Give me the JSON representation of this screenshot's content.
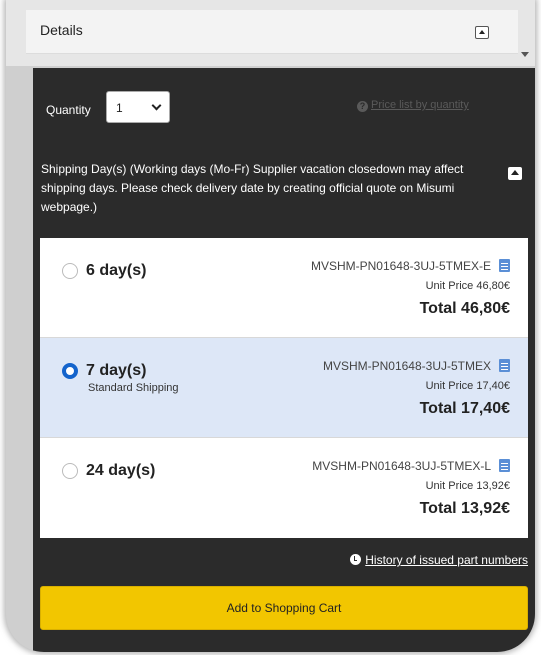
{
  "details": {
    "title": "Details"
  },
  "quantity": {
    "label": "Quantity",
    "selected": "1",
    "price_list_link": "Price list by quantity"
  },
  "shipping": {
    "header": "Shipping Day(s) (Working days (Mo-Fr) Supplier vacation closedown may affect shipping days. Please check delivery date by creating official quote on Misumi webpage.)",
    "options": [
      {
        "days": "6 day(s)",
        "note": "",
        "part_number": "MVSHM-PN01648-3UJ-5TMEX-E",
        "unit_price": "Unit Price 46,80€",
        "total": "Total 46,80€",
        "selected": false
      },
      {
        "days": "7 day(s)",
        "note": "Standard Shipping",
        "part_number": "MVSHM-PN01648-3UJ-5TMEX",
        "unit_price": "Unit Price 17,40€",
        "total": "Total 17,40€",
        "selected": true
      },
      {
        "days": "24 day(s)",
        "note": "",
        "part_number": "MVSHM-PN01648-3UJ-5TMEX-L",
        "unit_price": "Unit Price 13,92€",
        "total": "Total 13,92€",
        "selected": false
      }
    ]
  },
  "history_link": "History of issued part numbers",
  "cart_button": "Add to Shopping Cart",
  "icons": {
    "question": "question-circle-icon",
    "clock": "clock-icon",
    "document": "document-icon"
  },
  "colors": {
    "panel_bg": "#2b2b2b",
    "selected_row": "#dde7f7",
    "radio_accent": "#1464cc",
    "cart_button": "#f2c600"
  }
}
